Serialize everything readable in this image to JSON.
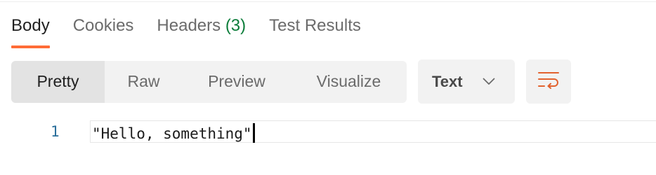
{
  "response_tabs": [
    {
      "label": "Body",
      "active": true
    },
    {
      "label": "Cookies",
      "active": false
    },
    {
      "label": "Headers",
      "count": "(3)",
      "active": false
    },
    {
      "label": "Test Results",
      "active": false
    }
  ],
  "view_modes": [
    {
      "label": "Pretty",
      "active": true
    },
    {
      "label": "Raw",
      "active": false
    },
    {
      "label": "Preview",
      "active": false
    },
    {
      "label": "Visualize",
      "active": false
    }
  ],
  "format_select": {
    "value": "Text",
    "icon": "chevron-down-icon"
  },
  "wrap_button": {
    "icon": "wrap-lines-icon"
  },
  "editor": {
    "lines": [
      {
        "number": "1",
        "text": "\"Hello, something\""
      }
    ]
  },
  "colors": {
    "accent": "#ff6c37",
    "count_green": "#0c7d3a",
    "line_number": "#2b6f9b"
  }
}
